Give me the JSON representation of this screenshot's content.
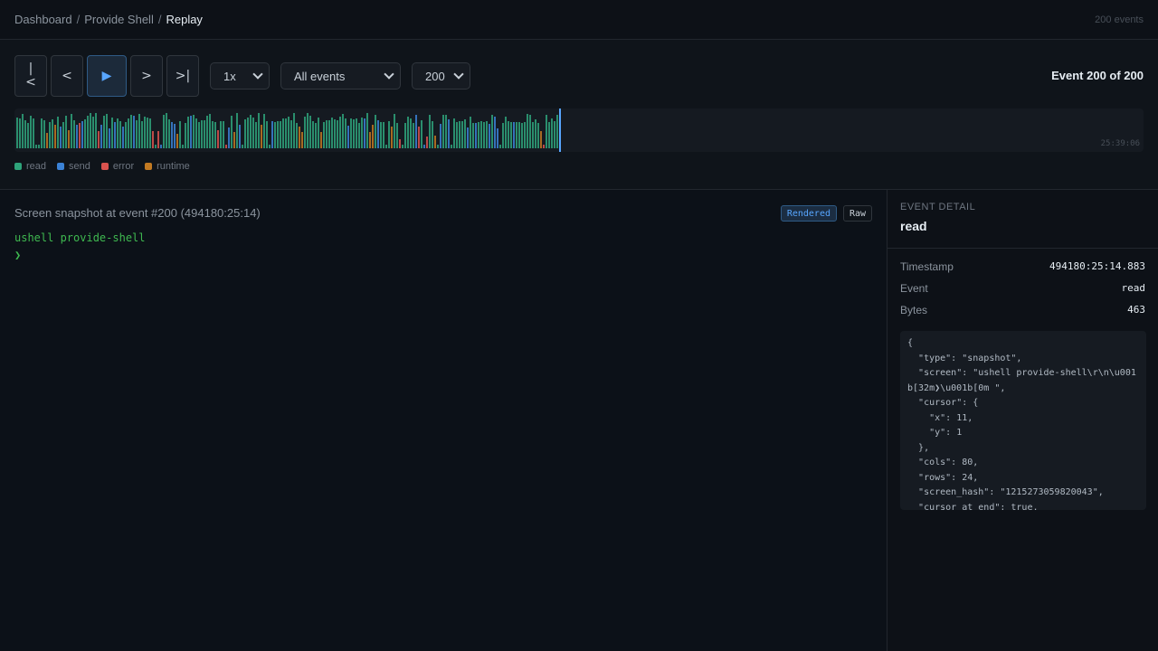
{
  "header": {
    "breadcrumbs": [
      "Dashboard",
      "Provide Shell",
      "Replay"
    ],
    "separator": "/",
    "event_count": "200 events"
  },
  "controls": {
    "buttons": {
      "first": "|<",
      "prev": "<",
      "play": "▶",
      "next": ">",
      "last": ">|"
    },
    "speed": {
      "selected": "1x"
    },
    "filter": {
      "selected": "All events"
    },
    "limit": {
      "selected": "200"
    },
    "position_label": "Event 200 of 200"
  },
  "timeline": {
    "end_time": "25:39:06",
    "total_events": 200,
    "current_index": 200,
    "colors": {
      "read": "#2ea37a",
      "send": "#3b82d6",
      "error": "#d9534f",
      "runtime": "#c27a22",
      "cursor": "#58a6ff"
    },
    "legend": [
      {
        "name": "read",
        "color": "#2ea37a"
      },
      {
        "name": "send",
        "color": "#3b82d6"
      },
      {
        "name": "error",
        "color": "#d9534f"
      },
      {
        "name": "runtime",
        "color": "#c27a22"
      }
    ]
  },
  "terminal": {
    "snapshot_title": "Screen snapshot at event #200 (494180:25:14)",
    "toggles": {
      "rendered": "Rendered",
      "raw": "Raw"
    },
    "lines": [
      "ushell provide-shell",
      "❯"
    ]
  },
  "detail": {
    "label": "EVENT DETAIL",
    "name": "read",
    "fields": [
      {
        "key": "Timestamp",
        "value": "494180:25:14.883"
      },
      {
        "key": "Event",
        "value": "read"
      },
      {
        "key": "Bytes",
        "value": "463"
      }
    ],
    "json": "{\n  \"type\": \"snapshot\",\n  \"screen\": \"ushell provide-shell\\r\\n\\u001b[32m❯\\u001b[0m \",\n  \"cursor\": {\n    \"x\": 11,\n    \"y\": 1\n  },\n  \"cols\": 80,\n  \"rows\": 24,\n  \"screen_hash\": \"1215273059820043\",\n  \"cursor_at_end\": true,\n}"
  }
}
